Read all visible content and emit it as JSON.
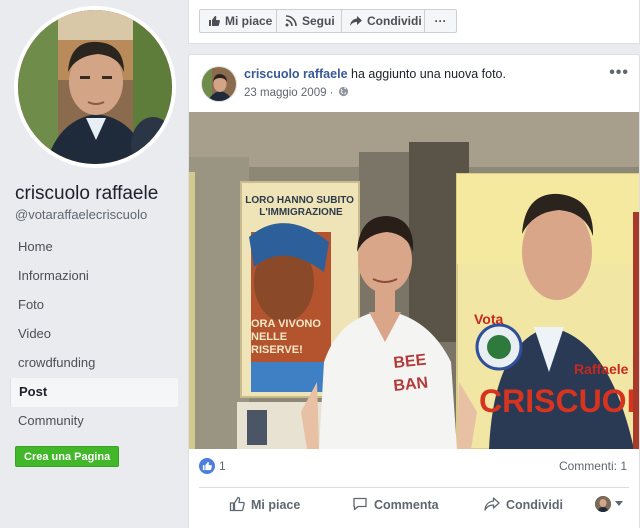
{
  "sidebar": {
    "page_name": "criscuolo raffaele",
    "handle": "@votaraffaelecriscuolo",
    "nav": [
      {
        "label": "Home"
      },
      {
        "label": "Informazioni"
      },
      {
        "label": "Foto"
      },
      {
        "label": "Video"
      },
      {
        "label": "crowdfunding"
      },
      {
        "label": "Post",
        "active": true
      },
      {
        "label": "Community"
      }
    ],
    "create_page_label": "Crea una Pagina"
  },
  "topbar": {
    "like_label": "Mi piace",
    "follow_label": "Segui",
    "share_label": "Condividi",
    "more_label": "···"
  },
  "post": {
    "author": "criscuolo raffaele",
    "action_text": " ha aggiunto una nuova foto.",
    "date": "23 maggio 2009 ·",
    "more_label": "•••",
    "poster_left_text": "LORO HANNO SUBITO L'IMMIGRAZIONE",
    "poster_left_bottom": "ORA VIVONO NELLE RISERVE!",
    "poster_right_vota": "Vota",
    "poster_right_name": "Raffaele",
    "poster_right_surname": "CRISCUOLO",
    "shirt_text": "BEE BAN",
    "like_count": "1",
    "comments_count": "Commenti: 1",
    "actions": {
      "like": "Mi piace",
      "comment": "Commenta",
      "share": "Condividi"
    }
  },
  "colors": {
    "link": "#385898",
    "green_button": "#42b72a",
    "like_blue": "#4a7fe0"
  },
  "icons": [
    "thumbs-up-icon",
    "rss-icon",
    "share-icon",
    "globe-icon",
    "comment-icon"
  ]
}
